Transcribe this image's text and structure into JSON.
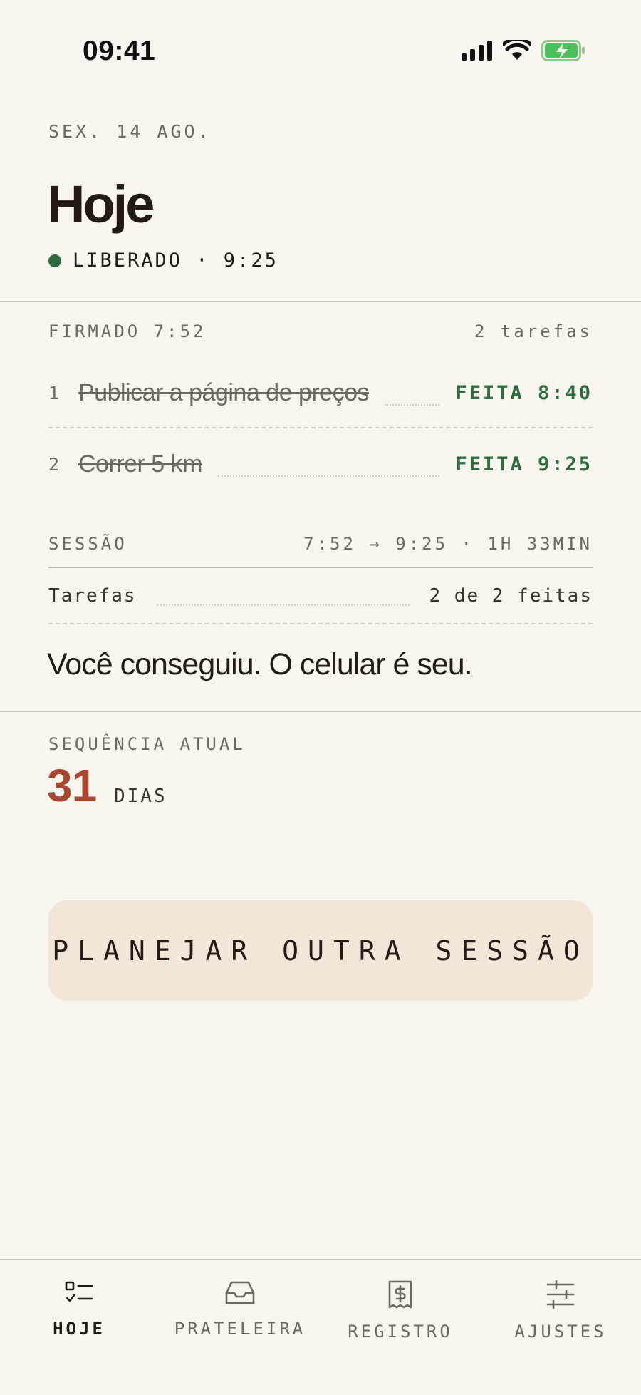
{
  "status_bar": {
    "time": "09:41"
  },
  "header": {
    "date": "SEX. 14 AGO.",
    "title": "Hoje",
    "status": "LIBERADO · 9:25"
  },
  "signed": {
    "label": "FIRMADO 7:52",
    "count": "2 tarefas",
    "tasks": [
      {
        "number": "1",
        "name": "Publicar a página de preços",
        "done": "FEITA 8:40"
      },
      {
        "number": "2",
        "name": "Correr 5 km",
        "done": "FEITA 9:25"
      }
    ]
  },
  "session": {
    "label": "SESSÃO",
    "range": "7:52 → 9:25 · 1H 33MIN",
    "tasks_label": "Tarefas",
    "tasks_value": "2 de 2 feitas",
    "message": "Você conseguiu. O celular é seu."
  },
  "streak": {
    "label": "SEQUÊNCIA ATUAL",
    "value": "31",
    "unit": "DIAS"
  },
  "plan_button": {
    "label": "PLANEJAR OUTRA SESSÃO"
  },
  "tabs": [
    {
      "label": "HOJE",
      "icon": "checklist-icon",
      "active": true
    },
    {
      "label": "PRATELEIRA",
      "icon": "inbox-tray-icon",
      "active": false
    },
    {
      "label": "REGISTRO",
      "icon": "receipt-dollar-icon",
      "active": false
    },
    {
      "label": "AJUSTES",
      "icon": "sliders-icon",
      "active": false
    }
  ],
  "colors": {
    "background": "#f8f4ee",
    "accent_green": "#2f6b3f",
    "streak_red": "#a8462f",
    "button_bg": "#f2e6d8"
  }
}
